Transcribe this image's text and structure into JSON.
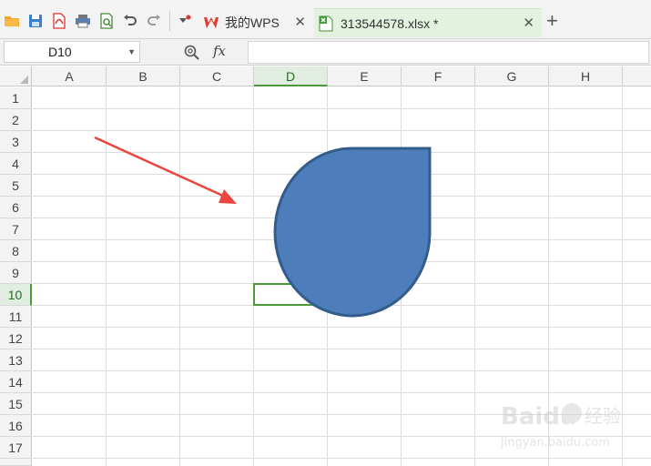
{
  "toolbar": {
    "icons": [
      "open-folder-icon",
      "save-icon",
      "export-pdf-icon",
      "print-icon",
      "print-preview-icon",
      "undo-icon",
      "redo-icon",
      "customize-toolbar-icon"
    ]
  },
  "tabs": [
    {
      "label": "我的WPS",
      "icon": "wps-logo-icon"
    },
    {
      "label": "313544578.xlsx *",
      "icon": "spreadsheet-file-icon",
      "active": true
    }
  ],
  "formula_bar": {
    "cell_reference": "D10",
    "fx_label": "fx",
    "formula_value": ""
  },
  "columns": [
    "A",
    "B",
    "C",
    "D",
    "E",
    "F",
    "G",
    "H"
  ],
  "rows": [
    "1",
    "2",
    "3",
    "4",
    "5",
    "6",
    "7",
    "8",
    "9",
    "10",
    "11",
    "12",
    "13",
    "14",
    "15",
    "16",
    "17"
  ],
  "selection": {
    "cell": "D10",
    "column": "D",
    "row": "10"
  },
  "shapes": [
    {
      "type": "teardrop",
      "fill": "#4d7ebb",
      "stroke": "#345c8b"
    },
    {
      "type": "arrow",
      "color": "#e8463e"
    }
  ],
  "watermark": {
    "brand": "Baidu",
    "cn": "经验",
    "url": "jingyan.baidu.com"
  },
  "colors": {
    "accent_green": "#4c9a3a",
    "active_tab_bg": "#e3f1df",
    "shape_fill": "#4d7ebb"
  }
}
